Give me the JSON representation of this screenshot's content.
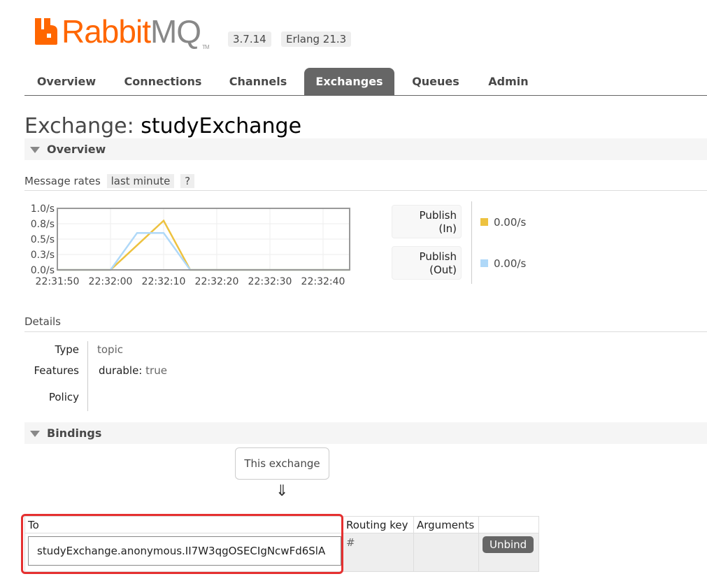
{
  "header": {
    "brand_primary": "Rabbit",
    "brand_secondary": "MQ",
    "brand_tm": "TM",
    "version": "3.7.14",
    "erlang": "Erlang 21.3",
    "colors": {
      "brand": "#ff6600",
      "tab_active": "#666666"
    }
  },
  "tabs": [
    {
      "label": "Overview",
      "active": false
    },
    {
      "label": "Connections",
      "active": false
    },
    {
      "label": "Channels",
      "active": false
    },
    {
      "label": "Exchanges",
      "active": true
    },
    {
      "label": "Queues",
      "active": false
    },
    {
      "label": "Admin",
      "active": false
    }
  ],
  "page": {
    "title_prefix": "Exchange:",
    "exchange_name": "studyExchange"
  },
  "overview": {
    "section_label": "Overview",
    "message_rates_label": "Message rates",
    "range_label": "last minute",
    "help_label": "?"
  },
  "chart_data": {
    "type": "line",
    "title": "",
    "x": [
      "22:31:50",
      "22:31:55",
      "22:32:00",
      "22:32:05",
      "22:32:10",
      "22:32:15",
      "22:32:20",
      "22:32:25",
      "22:32:30",
      "22:32:35",
      "22:32:40",
      "22:32:45"
    ],
    "x_tick_labels": [
      "22:31:50",
      "22:32:00",
      "22:32:10",
      "22:32:20",
      "22:32:30",
      "22:32:40"
    ],
    "y_tick_labels": [
      "1.0/s",
      "0.8/s",
      "0.5/s",
      "0.3/s",
      "0.0/s"
    ],
    "ylim": [
      0,
      1.0
    ],
    "grid": true,
    "series": [
      {
        "name": "Publish (In)",
        "color": "#edc240",
        "values": [
          0,
          0,
          0,
          0.4,
          0.8,
          0,
          0,
          0,
          0,
          0,
          0,
          0
        ]
      },
      {
        "name": "Publish (Out)",
        "color": "#afd8f8",
        "values": [
          0,
          0,
          0,
          0.6,
          0.6,
          0,
          0,
          0,
          0,
          0,
          0,
          0
        ]
      }
    ]
  },
  "legend": [
    {
      "label_line1": "Publish",
      "label_line2": "(In)",
      "value": "0.00/s",
      "color": "#edc240"
    },
    {
      "label_line1": "Publish",
      "label_line2": "(Out)",
      "value": "0.00/s",
      "color": "#afd8f8"
    }
  ],
  "details": {
    "label": "Details",
    "type_key": "Type",
    "type_value": "topic",
    "features_key": "Features",
    "features_name": "durable:",
    "features_value": "true",
    "policy_key": "Policy",
    "policy_value": ""
  },
  "bindings": {
    "section_label": "Bindings",
    "this_exchange_label": "This exchange",
    "arrow": "⇓",
    "columns": [
      "To",
      "Routing key",
      "Arguments",
      ""
    ],
    "rows": [
      {
        "to": "studyExchange.anonymous.II7W3qgOSECIgNcwFd6SlA",
        "routing_key": "#",
        "arguments": "",
        "action": "Unbind"
      }
    ]
  }
}
